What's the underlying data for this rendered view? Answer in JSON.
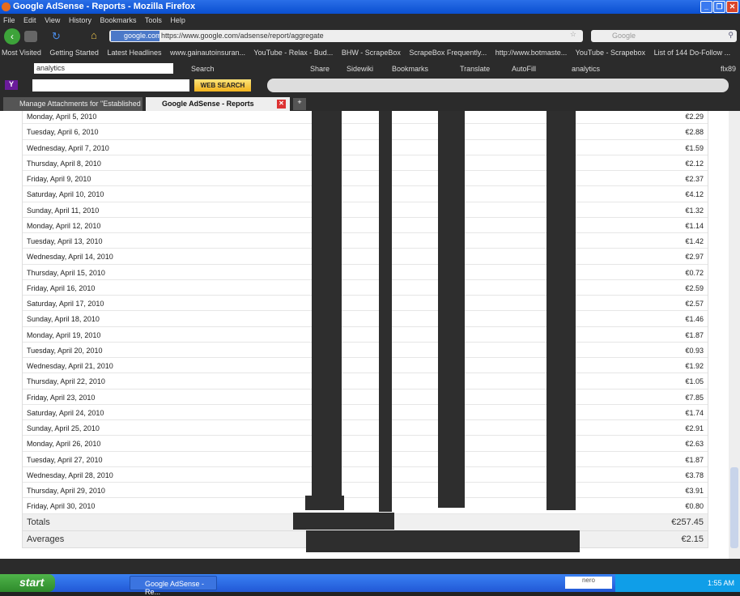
{
  "window": {
    "title": "Google AdSense - Reports - Mozilla Firefox"
  },
  "menu": [
    "File",
    "Edit",
    "View",
    "History",
    "Bookmarks",
    "Tools",
    "Help"
  ],
  "nav": {
    "site_label": "google.com",
    "url": "https://www.google.com/adsense/report/aggregate",
    "search_placeholder": "Google"
  },
  "bookmarks": [
    "Most Visited",
    "Getting Started",
    "Latest Headlines",
    "www.gainautoinsuran...",
    "YouTube - Relax - Bud...",
    "BHW - ScrapeBox",
    "ScrapeBox Frequently...",
    "http://www.botmaste...",
    "YouTube - Scrapebox",
    "List of 144 Do-Follow ..."
  ],
  "google_toolbar": {
    "query": "analytics",
    "items": [
      "Search",
      "Share",
      "Sidewiki",
      "Bookmarks",
      "Translate",
      "AutoFill",
      "analytics",
      "flx89"
    ]
  },
  "yahoo_toolbar": {
    "button": "WEB SEARCH"
  },
  "tabs": [
    {
      "label": "Manage Attachments for \"Established ...",
      "active": false
    },
    {
      "label": "Google AdSense - Reports",
      "active": true
    }
  ],
  "rows": [
    {
      "date": "Monday, April 5, 2010",
      "value": "€2.29"
    },
    {
      "date": "Tuesday, April 6, 2010",
      "value": "€2.88"
    },
    {
      "date": "Wednesday, April 7, 2010",
      "value": "€1.59"
    },
    {
      "date": "Thursday, April 8, 2010",
      "value": "€2.12"
    },
    {
      "date": "Friday, April 9, 2010",
      "value": "€2.37"
    },
    {
      "date": "Saturday, April 10, 2010",
      "value": "€4.12"
    },
    {
      "date": "Sunday, April 11, 2010",
      "value": "€1.32"
    },
    {
      "date": "Monday, April 12, 2010",
      "value": "€1.14"
    },
    {
      "date": "Tuesday, April 13, 2010",
      "value": "€1.42"
    },
    {
      "date": "Wednesday, April 14, 2010",
      "value": "€2.97"
    },
    {
      "date": "Thursday, April 15, 2010",
      "value": "€0.72"
    },
    {
      "date": "Friday, April 16, 2010",
      "value": "€2.59"
    },
    {
      "date": "Saturday, April 17, 2010",
      "value": "€2.57"
    },
    {
      "date": "Sunday, April 18, 2010",
      "value": "€1.46"
    },
    {
      "date": "Monday, April 19, 2010",
      "value": "€1.87"
    },
    {
      "date": "Tuesday, April 20, 2010",
      "value": "€0.93"
    },
    {
      "date": "Wednesday, April 21, 2010",
      "value": "€1.92"
    },
    {
      "date": "Thursday, April 22, 2010",
      "value": "€1.05"
    },
    {
      "date": "Friday, April 23, 2010",
      "value": "€7.85"
    },
    {
      "date": "Saturday, April 24, 2010",
      "value": "€1.74"
    },
    {
      "date": "Sunday, April 25, 2010",
      "value": "€2.91"
    },
    {
      "date": "Monday, April 26, 2010",
      "value": "€2.63"
    },
    {
      "date": "Tuesday, April 27, 2010",
      "value": "€1.87"
    },
    {
      "date": "Wednesday, April 28, 2010",
      "value": "€3.78"
    },
    {
      "date": "Thursday, April 29, 2010",
      "value": "€3.91"
    },
    {
      "date": "Friday, April 30, 2010",
      "value": "€0.80"
    }
  ],
  "totals": {
    "label": "Totals",
    "value": "€257.45"
  },
  "averages": {
    "label": "Averages",
    "value": "€2.15"
  },
  "taskbar": {
    "start": "start",
    "task": "Google AdSense - Re...",
    "clock": "1:55 AM",
    "tray_app": "nero"
  }
}
